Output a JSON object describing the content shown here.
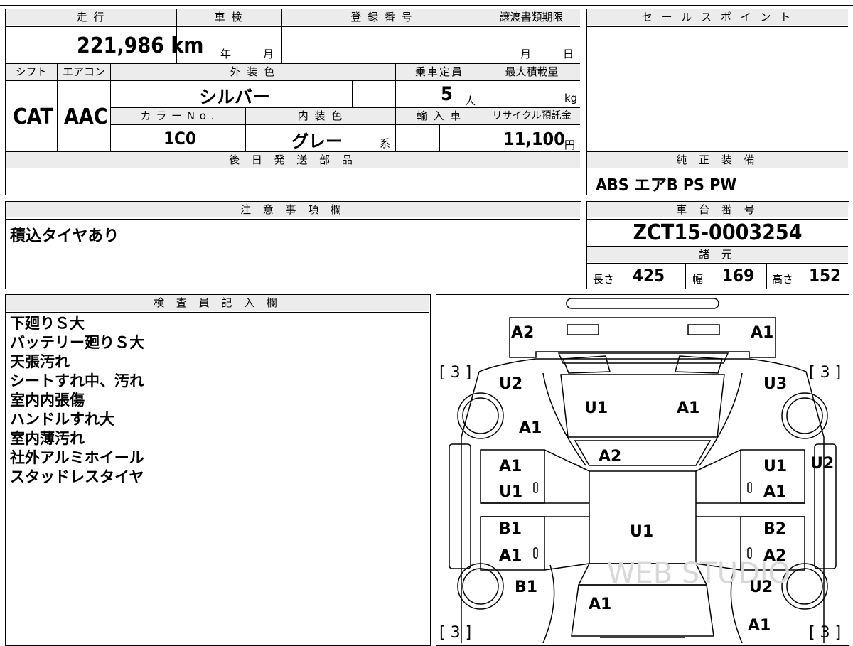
{
  "main": {
    "mileage_label": "走 行",
    "mileage_value": "221,986 km",
    "inspection_label": "車 検",
    "inspection_year_unit": "年",
    "inspection_month_unit": "月",
    "registration_label": "登 録 番 号",
    "deadline_label": "譲渡書類期限",
    "deadline_month_unit": "月",
    "deadline_day_unit": "日",
    "shift_label": "シフト",
    "shift_value": "CAT",
    "ac_label": "エアコン",
    "ac_value": "AAC",
    "exterior_color_label": "外 装 色",
    "exterior_color_value": "シルバー",
    "capacity_label": "乗車定員",
    "capacity_value": "5",
    "capacity_unit": "人",
    "max_load_label": "最大積載量",
    "max_load_unit": "kg",
    "color_no_label": "カ ラ ー N o .",
    "color_no_value": "1C0",
    "interior_color_label": "内 装 色",
    "interior_color_value": "グレー",
    "interior_color_suffix": "系",
    "import_label": "輸 入 車",
    "recycle_label": "リサイクル預託金",
    "recycle_value": "11,100",
    "recycle_unit": "円",
    "later_parts_label": "後 日 発 送 部 品"
  },
  "sales": {
    "label": "セ ー ル ス ポ イ ン ト",
    "standard_equipment_label": "純 正 装 備",
    "standard_equipment_value": "ABS エアB PS PW"
  },
  "notes": {
    "label": "注 意 事 項 欄",
    "text": "積込タイヤあり"
  },
  "chassis": {
    "label": "車 台 番 号",
    "value": "ZCT15-0003254",
    "specs_label": "諸 元",
    "length_label": "長さ",
    "length_value": "425",
    "width_label": "幅",
    "width_value": "169",
    "height_label": "高さ",
    "height_value": "152"
  },
  "inspector": {
    "label": "検 査 員 記 入 欄",
    "lines": [
      "下廻りＳ大",
      "バッテリー廻りＳ大",
      "天張汚れ",
      "シートすれ中、汚れ",
      "室内内張傷",
      "ハンドルすれ大",
      "室内薄汚れ",
      "社外アルミホイール",
      "スタッドレスタイヤ"
    ]
  },
  "diagram": {
    "watermark": "WEB STUDIO",
    "marks": {
      "rear_left": "A2",
      "rear_right": "A1",
      "tire_fl": "[ 3 ]",
      "tire_fr": "[ 3 ]",
      "tire_rl": "[ 3 ]",
      "tire_rr": "[ 3 ]",
      "quarter_left": "U2",
      "quarter_right": "U3",
      "roof_left": "U1",
      "roof_right": "A1",
      "pillar_left": "A1",
      "back_glass": "A2",
      "door_rl_top": "A1",
      "door_rl_bottom": "U1",
      "door_rr_top": "U1",
      "door_rr_bottom": "A1",
      "door_fl_top": "B1",
      "door_fl_bottom": "A1",
      "door_fr_top": "B2",
      "door_fr_bottom": "A2",
      "roof_center": "U1",
      "mirror_right": "U2",
      "fender_left": "B1",
      "fender_right": "U2",
      "hood": "A1",
      "front_right": "A1",
      "handle_0": "0"
    }
  }
}
